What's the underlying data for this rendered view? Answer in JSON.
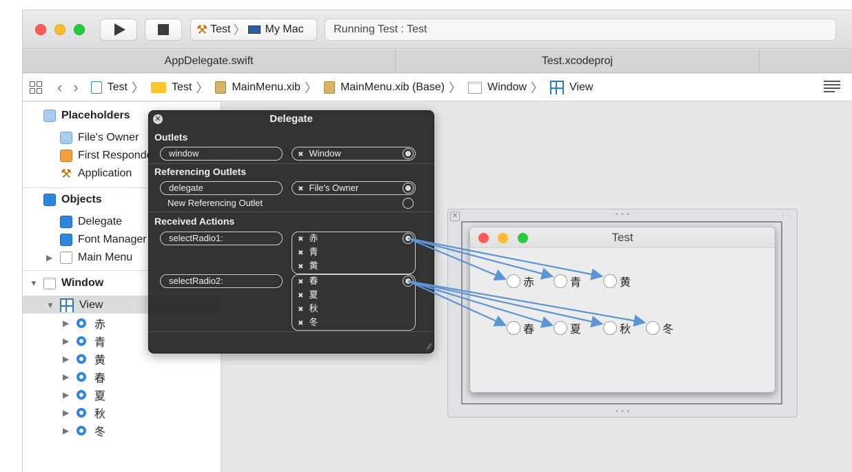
{
  "toolbar": {
    "scheme_target": "Test",
    "scheme_device": "My Mac",
    "status": "Running Test : Test"
  },
  "tabs": [
    "AppDelegate.swift",
    "Test.xcodeproj",
    ""
  ],
  "jumpbar": {
    "crumbs": [
      "Test",
      "Test",
      "MainMenu.xib",
      "MainMenu.xib (Base)",
      "Window",
      "View"
    ]
  },
  "outline": {
    "placeholders_header": "Placeholders",
    "files_owner": "File's Owner",
    "first_responder": "First Responder",
    "application": "Application",
    "objects_header": "Objects",
    "delegate": "Delegate",
    "font_manager": "Font Manager",
    "main_menu": "Main Menu",
    "window": "Window",
    "view": "View",
    "radios": [
      "赤",
      "青",
      "黄",
      "春",
      "夏",
      "秋",
      "冬"
    ]
  },
  "hud": {
    "title": "Delegate",
    "outlets_header": "Outlets",
    "outlet_name": "window",
    "outlet_target": "Window",
    "ref_header": "Referencing Outlets",
    "ref_name": "delegate",
    "ref_target": "File's Owner",
    "new_ref": "New Referencing Outlet",
    "actions_header": "Received Actions",
    "action1": "selectRadio1:",
    "action1_targets": [
      "赤",
      "青",
      "黄"
    ],
    "action2": "selectRadio2:",
    "action2_targets": [
      "春",
      "夏",
      "秋",
      "冬"
    ]
  },
  "preview": {
    "title": "Test",
    "row1": [
      "赤",
      "青",
      "黄"
    ],
    "row2": [
      "春",
      "夏",
      "秋",
      "冬"
    ]
  },
  "colors": {
    "connection": "#5b95d6",
    "accent": "#2f86de"
  }
}
